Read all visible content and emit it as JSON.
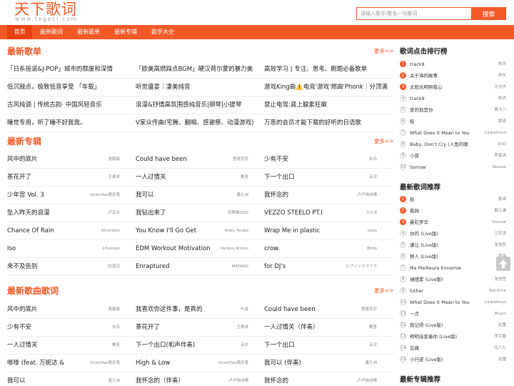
{
  "header": {
    "logo_main": "天下歌词",
    "logo_sub": "www.txgeci.com",
    "search_placeholder": "请输入歌手/歌名一句歌词",
    "search_button": "搜索"
  },
  "nav": [
    "首页",
    "最新歌词",
    "最新歌单",
    "最新专辑",
    "歌手大全"
  ],
  "more_label": "更多>>",
  "playlists": {
    "title": "最新歌单",
    "rows": [
      [
        "「日系摇滚&J-POP」城市的颓废和深情",
        "「欧美高燃踩点BGM」硬汉荷尔蒙的暴力美",
        "高效学习 | 专注、思考、刷题必备歌单"
      ],
      [
        "低沉鼓点，极致低音享受 「车载」",
        "听觉盛宴｜凄美纯音",
        "游戏King曲⚠️电竞'游戏'燃曲'Phonk｜分顶满"
      ],
      [
        "古风纯调 | 传统古韵· 中国风轻音乐",
        "浪漫&抒情高氛围感纯音乐|钢琴|小提琴",
        "禁止电驾:肾上腺素狂飙"
      ],
      [
        "睡觉专用，听了睡不好我我。",
        "V家众传曲(宅舞、翻唱、感谢祭、动漫游戏)",
        "万恶的会员才能下载的好听的日语歌"
      ]
    ]
  },
  "albums": {
    "title": "最新专辑",
    "rows": [
      [
        [
          "风中的底片",
          "张碧晨"
        ],
        [
          "Could have been",
          "登喜尼莎"
        ],
        [
          "少有不安",
          "玄鸟"
        ]
      ],
      [
        [
          "茶花开了",
          "王睿卓"
        ],
        [
          "一人过情关",
          "戴荃"
        ],
        [
          "下一个出口",
          "云汐"
        ]
      ],
      [
        [
          "少年宫 Vol. 3",
          "One&Two晚安鬼"
        ],
        [
          "我可以",
          "唐九洲"
        ],
        [
          "我怀念的",
          "卢卢快闭嘴"
        ]
      ],
      [
        [
          "坠入昨天的浪漫",
          "卢苡禾"
        ],
        [
          "我钻出来了",
          "邓典果DDG"
        ],
        [
          "VEZZO STEELO PT.I",
          "V.O.B"
        ]
      ],
      [
        [
          "Chance Of Rain",
          "Strandels"
        ],
        [
          "You Know I'll Go Get",
          "Rizky Ayuba"
        ],
        [
          "Wrap Me in plastic",
          "koka"
        ]
      ],
      [
        [
          "Iso",
          "10verses"
        ],
        [
          "EDM Workout Motivation",
          "Various Artists"
        ],
        [
          "crow.",
          "8bite"
        ]
      ],
      [
        [
          "来不及告别",
          "杜宣达"
        ],
        [
          "Enraptured",
          "MATANG"
        ],
        [
          "for DJ's",
          "ヒプノシスマイク"
        ]
      ]
    ]
  },
  "lyrics": {
    "title": "最新歌曲歌词",
    "rows": [
      [
        [
          "风中的底片",
          "张碧晨"
        ],
        [
          "我喜欢你这件事，是真的",
          "叶堂"
        ],
        [
          "Could have been",
          "登喜尼莎"
        ]
      ],
      [
        [
          "少有不安",
          "玄鸟"
        ],
        [
          "茶花开了",
          "王睿卓"
        ],
        [
          "一人过情关（伴奏）",
          "戴荃"
        ]
      ],
      [
        [
          "一人过情关",
          "戴荃"
        ],
        [
          "下一个出口(和声伴奏)",
          "云汐"
        ],
        [
          "下一个出口",
          "云汐"
        ]
      ],
      [
        [
          "嗲嗲 (feat. 万妮达 &",
          "One&Two晚安鬼"
        ],
        [
          "High & Low",
          "One&Two晚安鬼"
        ],
        [
          "我可以 (伴奏)",
          "唐九洲"
        ]
      ],
      [
        [
          "我可以",
          "唐九洲"
        ],
        [
          "我怀念的（伴奏）",
          "卢卢快闭嘴"
        ],
        [
          "我怀念的",
          "卢卢快闭嘴"
        ]
      ]
    ]
  },
  "sidebar": {
    "rank": {
      "title": "歌词点击排行榜",
      "items": [
        [
          "track8",
          "陈杰"
        ],
        [
          "关于海的故事",
          "柯东"
        ],
        [
          "太阳光明照我心",
          "文兆杰"
        ],
        [
          "track9",
          "陈杰"
        ],
        [
          "爱的就是你",
          "察卡八"
        ],
        [
          "船",
          "繁卓"
        ],
        [
          "What Does It Mean to You",
          "Carpetman"
        ],
        [
          "Baby, Don't Cry (人鱼的眼",
          "EXO"
        ],
        [
          "小孩",
          "罗森涛"
        ],
        [
          "Sorrow",
          "Sbazzo"
        ]
      ]
    },
    "recommend": {
      "title": "最新歌词推荐",
      "items": [
        [
          "船",
          "繁卓"
        ],
        [
          "瓶驹",
          "薛之谦"
        ],
        [
          "曼陀罗华",
          "Sasuke"
        ],
        [
          "你的 (Live版)",
          "汪苏泷"
        ],
        [
          "谦让 (Live版)",
          "张信哲"
        ],
        [
          "野人 (Live版)",
          "黄英"
        ],
        [
          "Ma Meilleure Ennemie",
          "黄英"
        ],
        [
          "裙摆素 (Live版)",
          "张信哲"
        ],
        [
          "luther",
          "Kendrick"
        ],
        [
          "What Does It Mean to You",
          "Carpetman"
        ],
        [
          "一点",
          "Muyoi"
        ],
        [
          "我记得 (Live版)",
          "赵雷"
        ],
        [
          "明明深爱着你 (Live版)",
          "李宇春"
        ],
        [
          "忘痛",
          "伍六七"
        ],
        [
          "小行迹 (Live版)",
          "赵雷"
        ]
      ]
    },
    "albums_title": "最新专辑推荐"
  },
  "colors": {
    "accent": "#f25a28",
    "nav_active": "#e84010"
  },
  "icons": {
    "scroll_top": "arrow-up-icon"
  }
}
